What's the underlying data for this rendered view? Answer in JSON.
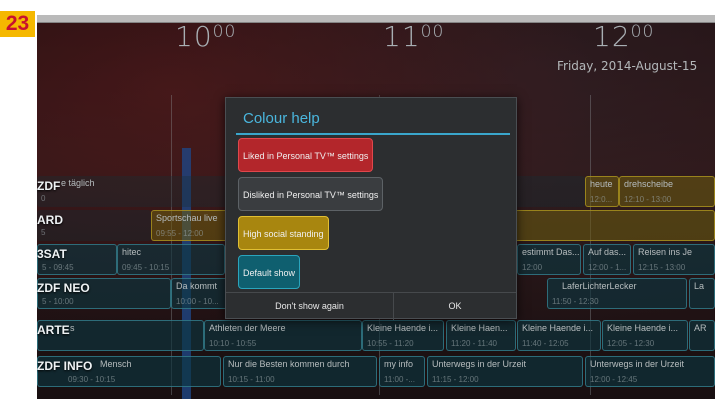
{
  "page_number": "23",
  "timeline": {
    "hours": [
      {
        "h": "10",
        "m": "00"
      },
      {
        "h": "11",
        "m": "00"
      },
      {
        "h": "12",
        "m": "00"
      }
    ],
    "date": "Friday, 2014-August-15"
  },
  "rows": [
    {
      "channel": "ZDF",
      "programs": [
        {
          "title": "e täglich",
          "time": "0"
        },
        {
          "title": "heute",
          "time": "12:0..."
        },
        {
          "title": "drehscheibe",
          "time": "12:10 - 13:00"
        }
      ]
    },
    {
      "channel": "ARD",
      "programs": [
        {
          "title": "",
          "time": "5"
        },
        {
          "title": "Sportschau live",
          "time": "09:55 - 12:00"
        }
      ]
    },
    {
      "channel": "3SAT",
      "programs": [
        {
          "title": "",
          "time": "5 - 09:45"
        },
        {
          "title": "hitec",
          "time": "09:45 - 10:15"
        },
        {
          "title": "estimmt Das...",
          "time": "12:00"
        },
        {
          "title": "Auf das...",
          "time": "12:00 - 1..."
        },
        {
          "title": "Reisen ins Je",
          "time": "12:15 - 13:00"
        }
      ]
    },
    {
      "channel": "ZDF NEO",
      "programs": [
        {
          "title": "",
          "time": "5 - 10:00"
        },
        {
          "title": "Da kommt",
          "time": "10:00 - 10..."
        },
        {
          "title": "LaferLichterLecker",
          "time": "11:50 - 12:30"
        },
        {
          "title": "La",
          "time": ""
        }
      ]
    },
    {
      "channel": "ARTE",
      "programs": [
        {
          "title": "s",
          "time": ""
        },
        {
          "title": "Athleten der Meere",
          "time": "10:10 - 10:55"
        },
        {
          "title": "Kleine Haende i...",
          "time": "10:55 - 11:20"
        },
        {
          "title": "Kleine Haen...",
          "time": "11:20 - 11:40"
        },
        {
          "title": "Kleine Haende i...",
          "time": "11:40 - 12:05"
        },
        {
          "title": "Kleine Haende i...",
          "time": "12:05 - 12:30"
        },
        {
          "title": "AR",
          "time": ""
        }
      ]
    },
    {
      "channel": "ZDF INFO",
      "programs": [
        {
          "title": "Mensch",
          "time": "09:30 - 10:15"
        },
        {
          "title": "Nur die Besten kommen durch",
          "time": "10:15 - 11:00"
        },
        {
          "title": "my info",
          "time": "11:00 -..."
        },
        {
          "title": "Unterwegs in der Urzeit",
          "time": "11:15 - 12:00"
        },
        {
          "title": "Unterwegs in der Urzeit",
          "time": "12:00 - 12:45"
        }
      ]
    }
  ],
  "dialog": {
    "title": "Colour help",
    "items": [
      {
        "label": "Liked in Personal TV™ settings",
        "color": "#b3262b"
      },
      {
        "label": "Disliked in Personal TV™ settings",
        "color": "#3a3d40"
      },
      {
        "label": "High social standing",
        "color": "#a8860f"
      },
      {
        "label": "Default show",
        "color": "#0f5f6f"
      }
    ],
    "dont_show_label": "Don't show again",
    "ok_label": "OK"
  },
  "colors": {
    "accent": "#4ab6dd",
    "page_badge": "#f5b800",
    "page_badge_text": "#c8102e"
  }
}
